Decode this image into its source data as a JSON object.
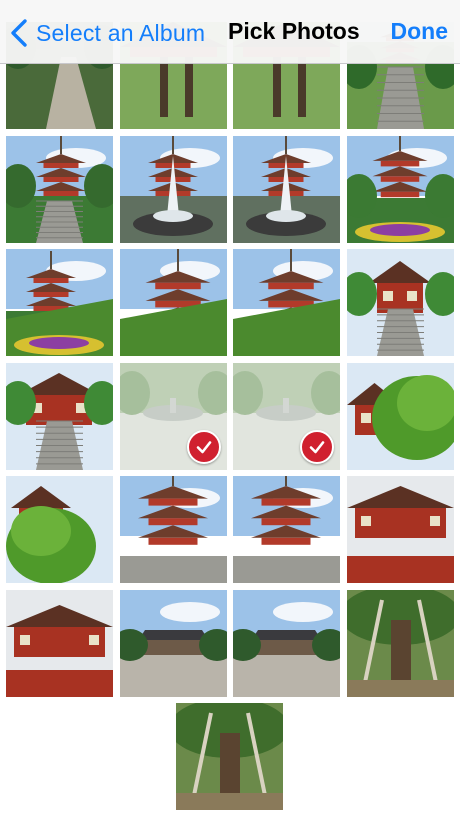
{
  "navbar": {
    "back_label": "Select an Album",
    "title": "Pick Photos",
    "done_label": "Done"
  },
  "colors": {
    "accent": "#147efb",
    "selection_badge": "#d0202f"
  },
  "photos": [
    {
      "scene": "garden-path",
      "selected": false
    },
    {
      "scene": "pagoda-roof-trees",
      "selected": false
    },
    {
      "scene": "pagoda-roof-trees",
      "selected": false
    },
    {
      "scene": "pagoda-steps-distant",
      "selected": false
    },
    {
      "scene": "pagoda-stairs-trees",
      "selected": false
    },
    {
      "scene": "fountain",
      "selected": false
    },
    {
      "scene": "fountain",
      "selected": false
    },
    {
      "scene": "pagoda-flowerbed",
      "selected": false
    },
    {
      "scene": "pagoda-hedge-flowerbed",
      "selected": false
    },
    {
      "scene": "pagoda-hedge-closeup",
      "selected": false
    },
    {
      "scene": "pagoda-hedge-closeup",
      "selected": false
    },
    {
      "scene": "gate-stairs",
      "selected": false
    },
    {
      "scene": "gate-stairs-wide",
      "selected": false
    },
    {
      "scene": "courtyard-fountain",
      "selected": true
    },
    {
      "scene": "courtyard-fountain",
      "selected": true
    },
    {
      "scene": "temple-maple",
      "selected": false
    },
    {
      "scene": "temple-maple-left",
      "selected": false
    },
    {
      "scene": "pagoda-tower",
      "selected": false
    },
    {
      "scene": "pagoda-tower",
      "selected": false
    },
    {
      "scene": "temple-facade",
      "selected": false
    },
    {
      "scene": "temple-facade-low",
      "selected": false
    },
    {
      "scene": "temple-plaza",
      "selected": false
    },
    {
      "scene": "temple-plaza",
      "selected": false
    },
    {
      "scene": "big-tree-props",
      "selected": false
    },
    {
      "scene": "big-tree-props",
      "selected": false
    }
  ]
}
